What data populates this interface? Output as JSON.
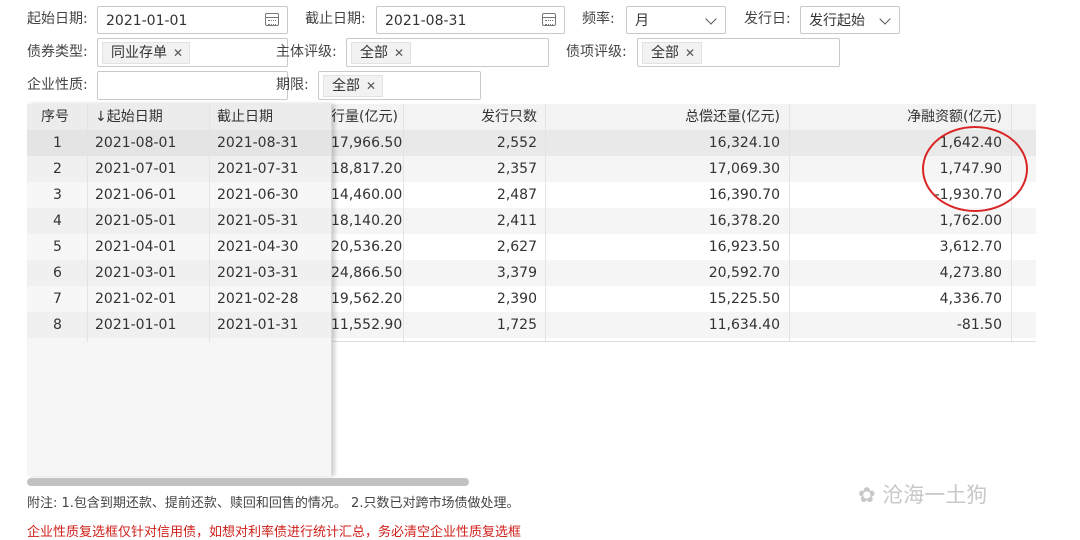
{
  "filters": {
    "start_date": {
      "label": "起始日期:",
      "value": "2021-01-01"
    },
    "end_date": {
      "label": "截止日期:",
      "value": "2021-08-31"
    },
    "frequency": {
      "label": "频率:",
      "value": "月"
    },
    "issue_day": {
      "label": "发行日:",
      "value": "发行起始"
    },
    "bond_type": {
      "label": "债券类型:",
      "tags": [
        "同业存单"
      ]
    },
    "issuer_rating": {
      "label": "主体评级:",
      "tags": [
        "全部"
      ]
    },
    "bond_rating": {
      "label": "债项评级:",
      "tags": [
        "全部"
      ]
    },
    "company_nature": {
      "label": "企业性质:",
      "value": ""
    },
    "term": {
      "label": "期限:",
      "tags": [
        "全部"
      ]
    }
  },
  "table": {
    "headers": {
      "seq": "序号",
      "start": "↓起始日期",
      "end": "截止日期",
      "issue_amount": "行量(亿元)",
      "issue_count": "发行只数",
      "repay": "总偿还量(亿元)",
      "net": "净融资额(亿元)"
    },
    "rows": [
      {
        "seq": "1",
        "start": "2021-08-01",
        "end": "2021-08-31",
        "issue_amount": "17,966.50",
        "issue_count": "2,552",
        "repay": "16,324.10",
        "net": "1,642.40"
      },
      {
        "seq": "2",
        "start": "2021-07-01",
        "end": "2021-07-31",
        "issue_amount": "18,817.20",
        "issue_count": "2,357",
        "repay": "17,069.30",
        "net": "1,747.90"
      },
      {
        "seq": "3",
        "start": "2021-06-01",
        "end": "2021-06-30",
        "issue_amount": "14,460.00",
        "issue_count": "2,487",
        "repay": "16,390.70",
        "net": "-1,930.70"
      },
      {
        "seq": "4",
        "start": "2021-05-01",
        "end": "2021-05-31",
        "issue_amount": "18,140.20",
        "issue_count": "2,411",
        "repay": "16,378.20",
        "net": "1,762.00"
      },
      {
        "seq": "5",
        "start": "2021-04-01",
        "end": "2021-04-30",
        "issue_amount": "20,536.20",
        "issue_count": "2,627",
        "repay": "16,923.50",
        "net": "3,612.70"
      },
      {
        "seq": "6",
        "start": "2021-03-01",
        "end": "2021-03-31",
        "issue_amount": "24,866.50",
        "issue_count": "3,379",
        "repay": "20,592.70",
        "net": "4,273.80"
      },
      {
        "seq": "7",
        "start": "2021-02-01",
        "end": "2021-02-28",
        "issue_amount": "19,562.20",
        "issue_count": "2,390",
        "repay": "15,225.50",
        "net": "4,336.70"
      },
      {
        "seq": "8",
        "start": "2021-01-01",
        "end": "2021-01-31",
        "issue_amount": "11,552.90",
        "issue_count": "1,725",
        "repay": "11,634.40",
        "net": "-81.50"
      }
    ]
  },
  "footer": {
    "note": "附注: 1.包含到期还款、提前还款、赎回和回售的情况。 2.只数已对跨市场债做处理。",
    "warning": "企业性质复选框仅针对信用债，如想对利率债进行统计汇总，务必清空企业性质复选框"
  },
  "watermark": "沧海一土狗",
  "colors": {
    "annotation_circle": "#d92525",
    "warning_text": "#d0201b",
    "selected_row": "#e9e9e9"
  }
}
